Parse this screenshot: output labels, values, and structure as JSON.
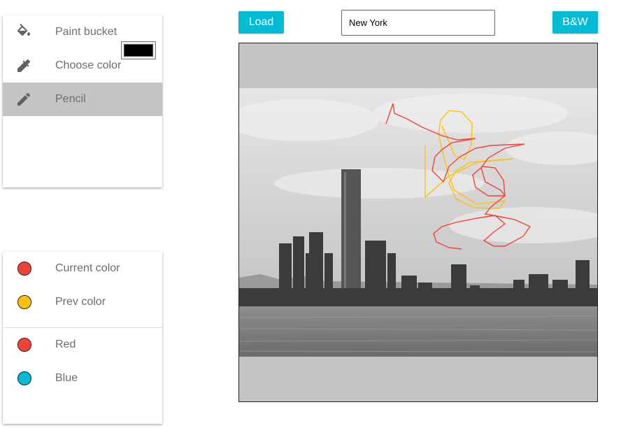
{
  "tools": [
    {
      "id": "paint-bucket",
      "label": "Paint bucket",
      "icon": "paint-bucket-icon"
    },
    {
      "id": "choose-color",
      "label": "Choose color",
      "icon": "eyedropper-icon"
    },
    {
      "id": "pencil",
      "label": "Pencil",
      "icon": "pencil-icon",
      "active": true
    }
  ],
  "chosen_color": "#000000",
  "colors_panel": {
    "current": {
      "label": "Current color",
      "color": "#f44336"
    },
    "prev": {
      "label": "Prev color",
      "color": "#ffc107"
    },
    "palette": [
      {
        "label": "Red",
        "color": "#f44336"
      },
      {
        "label": "Blue",
        "color": "#00bcd4"
      }
    ]
  },
  "toolbar": {
    "load_label": "Load",
    "city_value": "New York",
    "bw_label": "B&W"
  },
  "canvas": {
    "background": "#c4c4c4",
    "stroke_colors": [
      "#f44336",
      "#ffc107"
    ]
  }
}
